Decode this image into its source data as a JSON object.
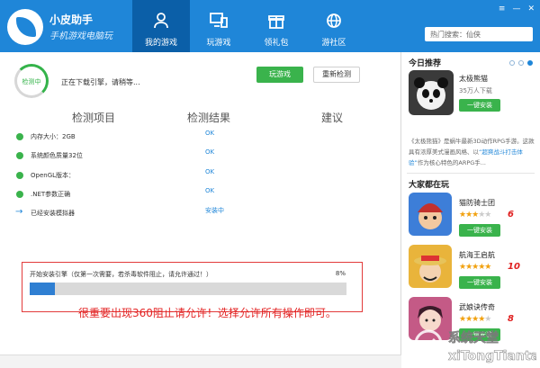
{
  "header": {
    "brand_name": "小皮助手",
    "brand_sub": "手机游戏电脑玩",
    "nav": [
      {
        "label": "我的游戏",
        "icon": "user-icon",
        "active": true
      },
      {
        "label": "玩游戏",
        "icon": "monitor-icon",
        "active": false
      },
      {
        "label": "领礼包",
        "icon": "gift-icon",
        "active": false
      },
      {
        "label": "游社区",
        "icon": "globe-icon",
        "active": false
      }
    ],
    "search_placeholder": "热门搜索：仙侠",
    "window_controls": [
      "≡",
      "—",
      "✕"
    ]
  },
  "status": {
    "ring_label": "检测中",
    "message": "正在下载引擎，请稍等...",
    "play_button": "玩游戏",
    "recheck_button": "重新检测"
  },
  "columns": [
    "检测项目",
    "检测结果",
    "建议"
  ],
  "checks": [
    {
      "label": "内存大小：2GB",
      "value": "OK",
      "state": "done"
    },
    {
      "label": "系统颜色质量32位",
      "value": "OK",
      "state": "done"
    },
    {
      "label": "OpenGL版本：",
      "value": "OK",
      "state": "done"
    },
    {
      "label": ".NET参数正确",
      "value": "OK",
      "state": "done"
    },
    {
      "label": "已经安装模拟器",
      "value": "安装中",
      "state": "running"
    }
  ],
  "install": {
    "text": "开始安装引擎（仅第一次需要，若杀毒软件阻止，请允许通过！）",
    "percent_label": "8%",
    "progress": 0.08
  },
  "notice": "很重要出现360阻止请允许！选择允许所有操作即可。",
  "sidebar": {
    "today_title": "今日推荐",
    "featured": {
      "name": "太极熊猫",
      "meta": "35万人下载",
      "button": "一键安装",
      "desc_prefix": "《太极熊猫》是蜗牛最新3D动作RPG手游。这款具有浓厚美式漫画风格、以",
      "desc_link": "“超爽战斗打击体验”",
      "desc_suffix": "作为核心特色的ARPG手..."
    },
    "playing_title": "大家都在玩",
    "playing": [
      {
        "name": "猫防骑士团",
        "rating": 3,
        "score": "6",
        "button": "一键安装"
      },
      {
        "name": "航海王启航",
        "rating": 5,
        "score": "10",
        "button": "一键安装"
      },
      {
        "name": "武娘诀传奇",
        "rating": 4,
        "score": "8",
        "button": "一键安装"
      }
    ],
    "watermark": "系统天堂"
  },
  "colors": {
    "header_blue": "#1f86d8",
    "nav_active": "#0b5fa8",
    "green": "#3ab34c",
    "alert_red": "#e32222"
  }
}
